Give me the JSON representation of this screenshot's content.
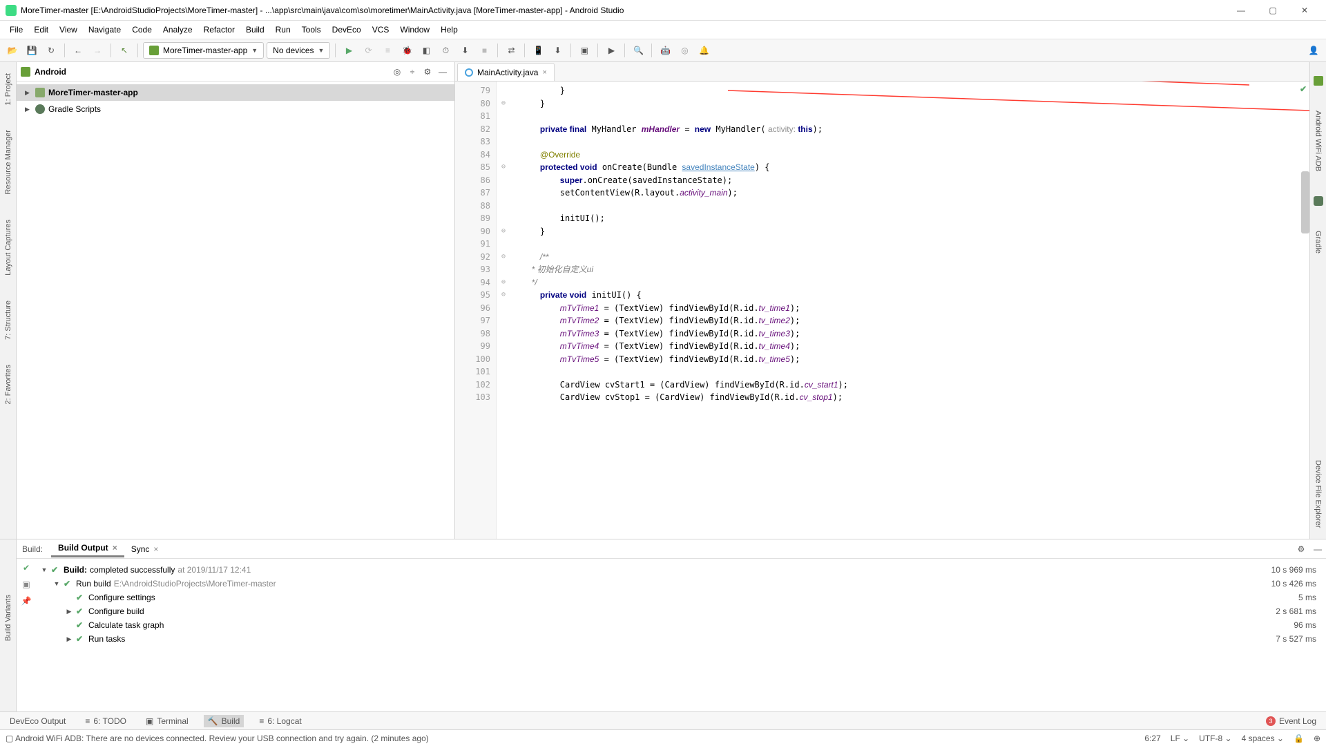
{
  "window": {
    "title": "MoreTimer-master [E:\\AndroidStudioProjects\\MoreTimer-master] - ...\\app\\src\\main\\java\\com\\so\\moretimer\\MainActivity.java [MoreTimer-master-app] - Android Studio"
  },
  "menu": [
    "File",
    "Edit",
    "View",
    "Navigate",
    "Code",
    "Analyze",
    "Refactor",
    "Build",
    "Run",
    "Tools",
    "DevEco",
    "VCS",
    "Window",
    "Help"
  ],
  "toolbar": {
    "config": "MoreTimer-master-app",
    "devices": "No devices"
  },
  "project": {
    "label": "Android",
    "items": [
      {
        "name": "MoreTimer-master-app"
      },
      {
        "name": "Gradle Scripts"
      }
    ]
  },
  "left_tabs": [
    "1: Project",
    "Resource Manager",
    "Layout Captures",
    "7: Structure",
    "2: Favorites"
  ],
  "right_tabs": [
    "Android WiFi ADB",
    "Gradle",
    "Device File Explorer"
  ],
  "editor": {
    "tab": "MainActivity.java",
    "lines_start": 79,
    "lines_end": 103
  },
  "build": {
    "label": "Build:",
    "tabs": [
      "Build Output",
      "Sync"
    ],
    "rows": [
      {
        "indent": 0,
        "arrow": "▼",
        "bold": "Build:",
        "text": "completed successfully",
        "dim": "at 2019/11/17 12:41",
        "time": "10 s 969 ms"
      },
      {
        "indent": 1,
        "arrow": "▼",
        "text": "Run build",
        "dim": "E:\\AndroidStudioProjects\\MoreTimer-master",
        "time": "10 s 426 ms"
      },
      {
        "indent": 2,
        "arrow": "",
        "text": "Configure settings",
        "time": "5 ms"
      },
      {
        "indent": 2,
        "arrow": "▶",
        "text": "Configure build",
        "time": "2 s 681 ms"
      },
      {
        "indent": 2,
        "arrow": "",
        "text": "Calculate task graph",
        "time": "96 ms"
      },
      {
        "indent": 2,
        "arrow": "▶",
        "text": "Run tasks",
        "time": "7 s 527 ms"
      }
    ]
  },
  "bottom_left_tabs": [
    "Build Variants"
  ],
  "bottom": {
    "deveco": "DevEco Output",
    "todo": "6: TODO",
    "terminal": "Terminal",
    "build": "Build",
    "logcat": "6: Logcat",
    "eventlog": "Event Log",
    "event_count": "3"
  },
  "status": {
    "msg": "Android WiFi ADB: There are no devices connected. Review your USB connection and try again. (2 minutes ago)",
    "pos": "6:27",
    "lf": "LF",
    "enc": "UTF-8",
    "indent": "4 spaces"
  }
}
